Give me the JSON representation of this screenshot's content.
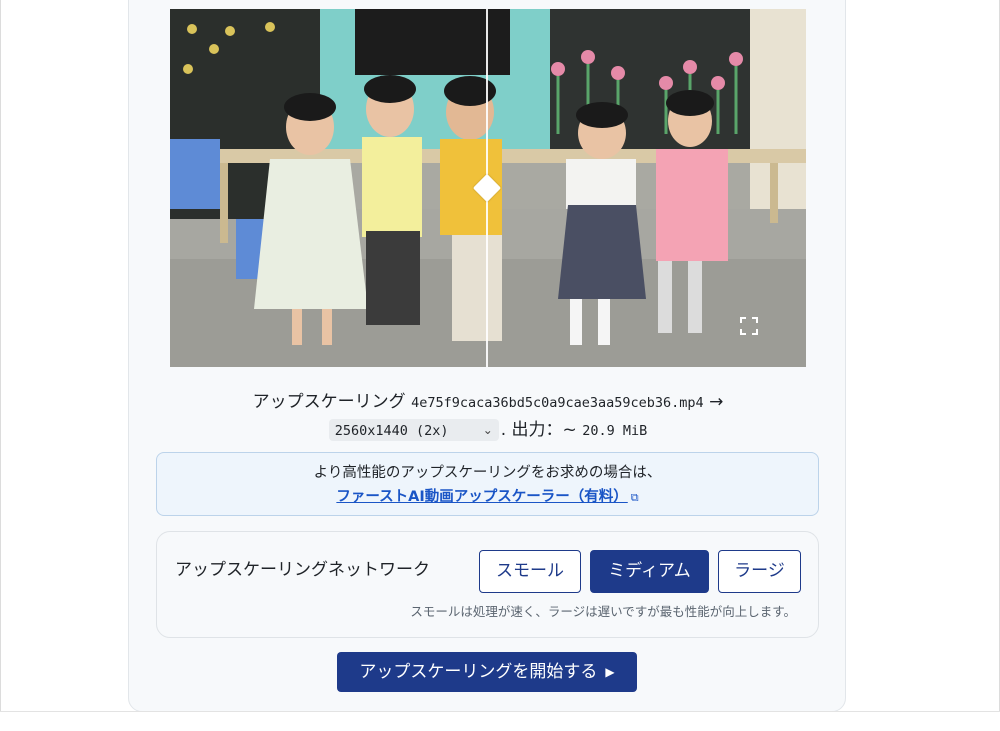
{
  "preview": {
    "scene": "video-frame-children-classroom"
  },
  "info": {
    "prefix": "アップスケーリング",
    "filename": "4e75f9caca36bd5c0a9cae3aa59ceb36.mp4",
    "arrow": "→",
    "resolution_option": "2560x1440 (2x)",
    "output_label": ". 出力：~",
    "output_size": "20.9 MiB"
  },
  "banner": {
    "text": "より高性能のアップスケーリングをお求めの場合は、",
    "link_label": "ファーストAI動画アップスケーラー（有料）"
  },
  "network": {
    "label": "アップスケーリングネットワーク",
    "options": [
      "スモール",
      "ミディアム",
      "ラージ"
    ],
    "selected": "ミディアム",
    "hint": "スモールは処理が速く、ラージは遅いですが最も性能が向上します。"
  },
  "start_button": {
    "label": "アップスケーリングを開始する"
  },
  "colors": {
    "accent": "#1e3a8a",
    "link": "#1a55c6",
    "banner_bg": "#eef5fc"
  }
}
